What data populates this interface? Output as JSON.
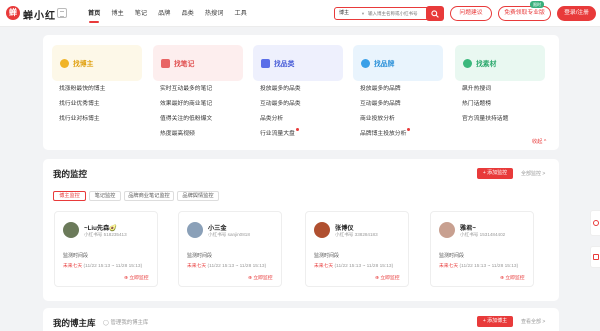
{
  "header": {
    "logo_char": "蝉",
    "logo_text": "蝉小红",
    "nav": [
      "首页",
      "博主",
      "笔记",
      "品牌",
      "品类",
      "热搜词",
      "工具"
    ],
    "search": {
      "category": "博主",
      "placeholder": "输入博主名称或小红书号"
    },
    "feedback": "问题建议",
    "trial": "免费领取专业版",
    "trial_badge": "限时",
    "login": "登录/注册"
  },
  "categories": [
    {
      "title": "找博主",
      "icon": "emoji-icon",
      "color": "#f0b428",
      "bg": "#fdf8e8",
      "links": [
        "找涨粉最快的博主",
        "找行业优秀博主",
        "找行业对标博主"
      ]
    },
    {
      "title": "找笔记",
      "icon": "note-icon",
      "color": "#e86464",
      "bg": "#fdeeee",
      "links": [
        "实时互动最多的笔记",
        "效果最好的商业笔记",
        "值得关注的低粉爆文",
        "热度最高视频"
      ]
    },
    {
      "title": "找品类",
      "icon": "box-icon",
      "color": "#5a6ee8",
      "bg": "#eef0fd",
      "links": [
        "投放最多的品类",
        "互动最多的品类",
        "品类分析",
        "行业流量大盘"
      ]
    },
    {
      "title": "找品牌",
      "icon": "leaf-icon",
      "color": "#3aa0e8",
      "bg": "#e9f4fd",
      "links": [
        "投放最多的品牌",
        "互动最多的品牌",
        "商业投放分析",
        "品牌博主投放分析"
      ]
    },
    {
      "title": "找素材",
      "icon": "clover-icon",
      "color": "#3ab87c",
      "bg": "#e9f8f1",
      "links": [
        "飙升热搜词",
        "热门话题榜",
        "官方流量扶持话题"
      ]
    }
  ],
  "collapse": "收起 ^",
  "monitor": {
    "title": "我的监控",
    "add": "+ 添加监控",
    "all": "全部监控 >",
    "tabs": [
      "博主监控",
      "笔记监控",
      "品牌商业笔记监控",
      "品牌舆情监控"
    ],
    "cards": [
      {
        "name": "~Liu先森🥑",
        "id": "小红书号 518235413",
        "avatar": "#6b7a5a",
        "label": "监测时间段",
        "future": "未来七天",
        "range": "(11/22 15:13 ~ 11/28 15:13)",
        "action": "立即监控"
      },
      {
        "name": "小三金",
        "id": "小红书号 sanjin0818",
        "avatar": "#8aa0b8",
        "label": "监测时间段",
        "future": "未来七天",
        "range": "(11/22 15:13 ~ 11/28 15:13)",
        "action": "立即监控"
      },
      {
        "name": "张博仪",
        "id": "小红书号 338284183",
        "avatar": "#b05030",
        "label": "监测时间段",
        "future": "未来七天",
        "range": "(11/22 15:13 ~ 11/28 15:13)",
        "action": "立即监控"
      },
      {
        "name": "雅君~",
        "id": "小红书号 1531484402",
        "avatar": "#c8a090",
        "label": "监测时间段",
        "future": "未来七天",
        "range": "(11/22 15:13 ~ 11/28 15:13)",
        "action": "立即监控"
      }
    ]
  },
  "library": {
    "title": "我的博主库",
    "manage": "管理我的博主库",
    "add": "+ 添加博主",
    "all": "查看全部 >"
  }
}
